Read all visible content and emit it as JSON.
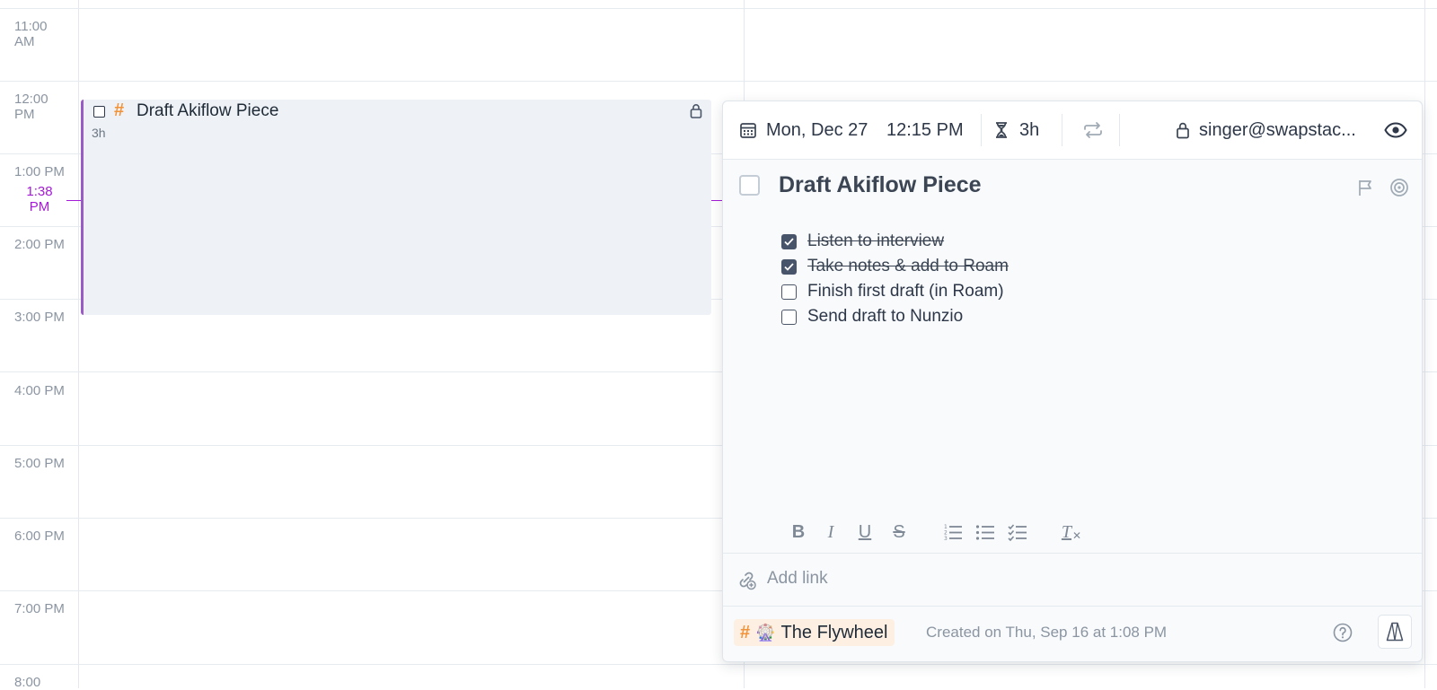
{
  "calendar": {
    "hours": [
      "11:00 AM",
      "12:00 PM",
      "1:00 PM",
      "2:00 PM",
      "3:00 PM",
      "4:00 PM",
      "5:00 PM",
      "6:00 PM",
      "7:00 PM",
      "8:00"
    ],
    "now_label": "1:38 PM",
    "now_color": "#a31bd6",
    "event": {
      "title": "Draft Akiflow Piece",
      "tag_symbol": "#",
      "duration": "3h",
      "lock_icon": "lock-icon"
    }
  },
  "popup": {
    "header": {
      "date": "Mon, Dec 27",
      "time": "12:15 PM",
      "duration": "3h",
      "owner": "singer@swapstac...",
      "icons": [
        "calendar-icon",
        "hourglass-icon",
        "repeat-icon",
        "lock-icon",
        "eye-icon"
      ]
    },
    "task": {
      "title": "Draft Akiflow Piece",
      "checklist": [
        {
          "text": "Listen to interview",
          "done": true
        },
        {
          "text": "Take notes & add to Roam",
          "done": true
        },
        {
          "text": "Finish first draft (in Roam)",
          "done": false
        },
        {
          "text": "Send draft to Nunzio",
          "done": false
        }
      ]
    },
    "toolbar": {
      "bold": "B",
      "italic": "I",
      "underline": "U",
      "strike": "S",
      "clear_format": "T"
    },
    "link": {
      "label": "Add link"
    },
    "footer": {
      "tag_symbol": "#",
      "tag_emoji": "🎡",
      "tag_name": "The Flywheel",
      "tag_color": "#f29339",
      "created": "Created on Thu, Sep 16 at 1:08 PM"
    }
  }
}
